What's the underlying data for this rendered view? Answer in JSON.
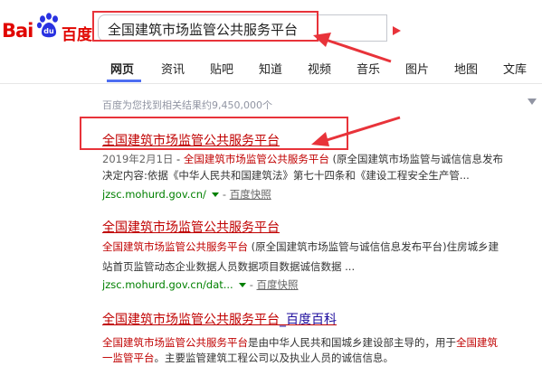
{
  "header": {
    "logo_bai": "Bai",
    "logo_du": "du",
    "logo_cn": "百度",
    "search_query": "全国建筑市场监管公共服务平台"
  },
  "tabs": [
    {
      "label": "网页",
      "active": true
    },
    {
      "label": "资讯",
      "active": false
    },
    {
      "label": "贴吧",
      "active": false
    },
    {
      "label": "知道",
      "active": false
    },
    {
      "label": "视频",
      "active": false
    },
    {
      "label": "音乐",
      "active": false
    },
    {
      "label": "图片",
      "active": false
    },
    {
      "label": "地图",
      "active": false
    },
    {
      "label": "文库",
      "active": false
    }
  ],
  "result_count": "百度为您找到相关结果约9,450,000个",
  "results": [
    {
      "title": "全国建筑市场监管公共服务平台",
      "title_suffix": "",
      "snippet_date": "2019年2月1日",
      "snippet_dash": " - ",
      "snippet_red": "全国建筑市场监管公共服务平台",
      "snippet_rest": " (原全国建筑市场监管与诚信信息发布",
      "snippet_line2": "决定内容:依据《中华人民共和国建筑法》第七十四条和《建设工程安全生产管...",
      "url": "jzsc.mohurd.gov.cn/",
      "snapshot": "百度快照"
    },
    {
      "title": "全国建筑市场监管公共服务平台",
      "title_suffix": "",
      "snippet_red": "全国建筑市场监管公共服务平台",
      "snippet_rest": " (原全国建筑市场监管与诚信信息发布平台)住房城乡建",
      "snippet_line2": "站首页监管动态企业数据人员数据项目数据诚信数据 ...",
      "url": "jzsc.mohurd.gov.cn/dat...",
      "snapshot": "百度快照"
    },
    {
      "title": "全国建筑市场监管公共服务平台",
      "title_suffix": "_百度百科",
      "snippet_red": "全国建筑市场监管公共服务平台",
      "snippet_rest": "是由中华人民共和国城乡建设部主导的，用于",
      "snippet_red_tail": "全国建筑",
      "snippet_line2_red": "一监管平台",
      "snippet_line2": "。主要监管建筑工程公司以及执业人员的诚信信息。"
    }
  ],
  "colors": {
    "brand_red": "#e10601",
    "brand_blue": "#2932e1",
    "active_tab": "#4e6ef2",
    "annotation_red": "#e8333a",
    "link_red": "#c00000",
    "url_green": "#008000"
  }
}
